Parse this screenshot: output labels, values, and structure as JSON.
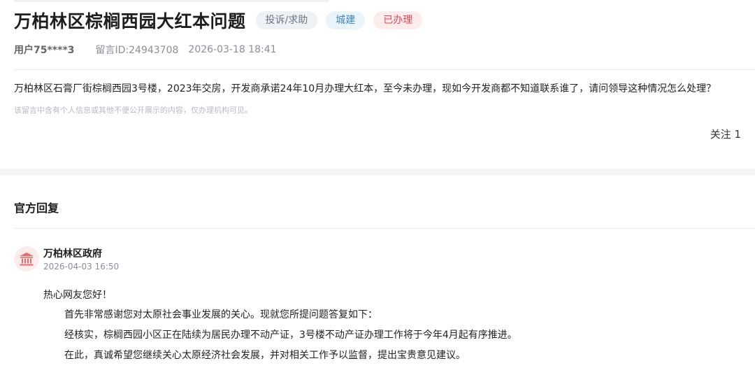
{
  "question": {
    "title": "万柏林区棕榈西园大红本问题",
    "tags": {
      "type": "投诉/求助",
      "category": "城建",
      "status": "已办理"
    },
    "user": "用户75****3",
    "message_id": "留言ID:24943708",
    "datetime": "2026-03-18 18:41",
    "content": "万柏林区石膏厂街棕榈西园3号楼，2023年交房，开发商承诺24年10月办理大红本，至今未办理，现如今开发商都不知道联系谁了，请问领导这种情况怎么处理？",
    "privacy_notice": "该留言中含有个人信息或其他不便公开展示的内容，仅办理机构可见。",
    "follow": "关注 1"
  },
  "official_reply": {
    "section_title": "官方回复",
    "org_name": "万柏林区政府",
    "datetime": "2026-04-03 16:50",
    "greeting": "热心网友您好！",
    "lines": [
      "首先非常感谢您对太原社会事业发展的关心。现就您所提问题答复如下：",
      "经核实，棕榈西园小区正在陆续为居民办理不动产证，3号楼不动产证办理工作将于今年4月起有序推进。",
      "在此，真诚希望您继续关心太原经济社会发展，并对相关工作予以监督，提出宝贵意见建议。"
    ]
  },
  "colors": {
    "status_red": "#e5484d",
    "category_blue": "#3f86c6",
    "avatar_icon": "#e86a6a"
  },
  "icons": {
    "avatar": "government-building-icon"
  }
}
